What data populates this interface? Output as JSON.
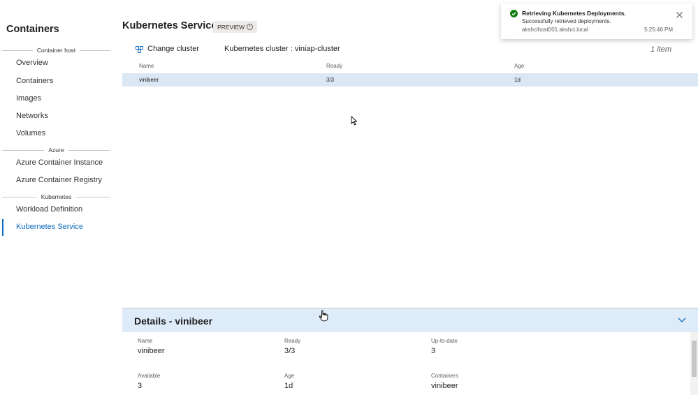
{
  "sidebar": {
    "title": "Containers",
    "groups": [
      {
        "label": "Container host"
      },
      {
        "label": "Azure"
      },
      {
        "label": "Kubernetes"
      }
    ],
    "items": [
      {
        "label": "Overview"
      },
      {
        "label": "Containers"
      },
      {
        "label": "Images"
      },
      {
        "label": "Networks"
      },
      {
        "label": "Volumes"
      },
      {
        "label": "Azure Container Instance"
      },
      {
        "label": "Azure Container Registry"
      },
      {
        "label": "Workload Definition"
      },
      {
        "label": "Kubernetes Service"
      }
    ],
    "active_item": "Kubernetes Service"
  },
  "header": {
    "title": "Kubernetes Service",
    "badge": "PREVIEW",
    "badge_icon": "info-icon"
  },
  "toolbar": {
    "change_cluster_label": "Change cluster",
    "change_cluster_icon": "change-cluster-icon",
    "cluster_label": "Kubernetes cluster : viniap-cluster",
    "item_count": "1 item"
  },
  "table": {
    "columns": [
      "Name",
      "Ready",
      "Age"
    ],
    "rows": [
      {
        "name": "vinibeer",
        "ready": "3/3",
        "age": "1d"
      }
    ]
  },
  "details": {
    "title": "Details - vinibeer",
    "fields": [
      {
        "label": "Name",
        "value": "vinibeer"
      },
      {
        "label": "Ready",
        "value": "3/3"
      },
      {
        "label": "Up-to-date",
        "value": "3"
      },
      {
        "label": "Available",
        "value": "3"
      },
      {
        "label": "Age",
        "value": "1d"
      },
      {
        "label": "Containers",
        "value": "vinibeer"
      }
    ]
  },
  "toast": {
    "title": "Retrieving Kubernetes Deployments.",
    "message": "Successfully retrieved deployments.",
    "host": "akshcihost001.akshci.local",
    "time": "5:25:46 PM",
    "status_color": "#107c10"
  },
  "colors": {
    "accent": "#0f6cbd",
    "selected_row": "#dbe8f4",
    "details_header": "#deecf9"
  }
}
